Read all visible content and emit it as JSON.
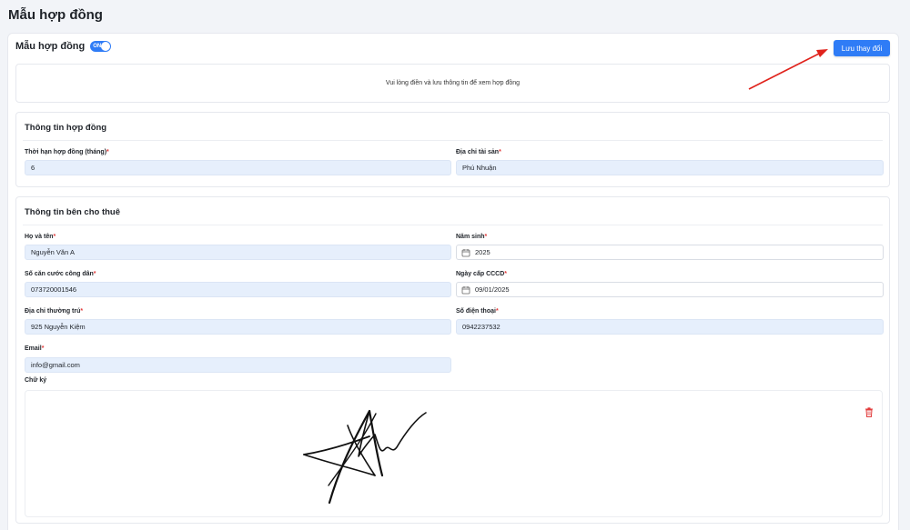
{
  "page": {
    "title": "Mẫu hợp đồng"
  },
  "header": {
    "label": "Mẫu hợp đồng",
    "toggle_text": "ON",
    "save_label": "Lưu thay đổi"
  },
  "notice": {
    "text": "Vui lòng điền và lưu thông tin để xem hợp đồng"
  },
  "contract_info": {
    "title": "Thông tin hợp đồng",
    "duration_label": "Thời hạn hợp đồng (tháng)",
    "duration_value": "6",
    "address_label": "Địa chỉ tài sản",
    "address_value": "Phú Nhuận"
  },
  "lessor_info": {
    "title": "Thông tin bên cho thuê",
    "name_label": "Họ và tên",
    "name_value": "Nguyễn Văn A",
    "birth_year_label": "Năm sinh",
    "birth_year_value": "2025",
    "id_label": "Số căn cước công dân",
    "id_value": "073720001546",
    "id_date_label": "Ngày cấp CCCD",
    "id_date_value": "09/01/2025",
    "residence_label": "Địa chỉ thường trú",
    "residence_value": "925 Nguyễn Kiệm",
    "phone_label": "Số điện thoại",
    "phone_value": "0942237532",
    "email_label": "Email",
    "email_value": "info@gmail.com",
    "signature_label": "Chữ ký"
  },
  "required_mark": "*",
  "colors": {
    "accent": "#2f7cf6",
    "required": "#e23b3b",
    "annotation_arrow": "#e0231c",
    "input_fill": "#e6effc"
  },
  "icons": {
    "date": "calendar-icon",
    "delete": "trash-icon"
  }
}
